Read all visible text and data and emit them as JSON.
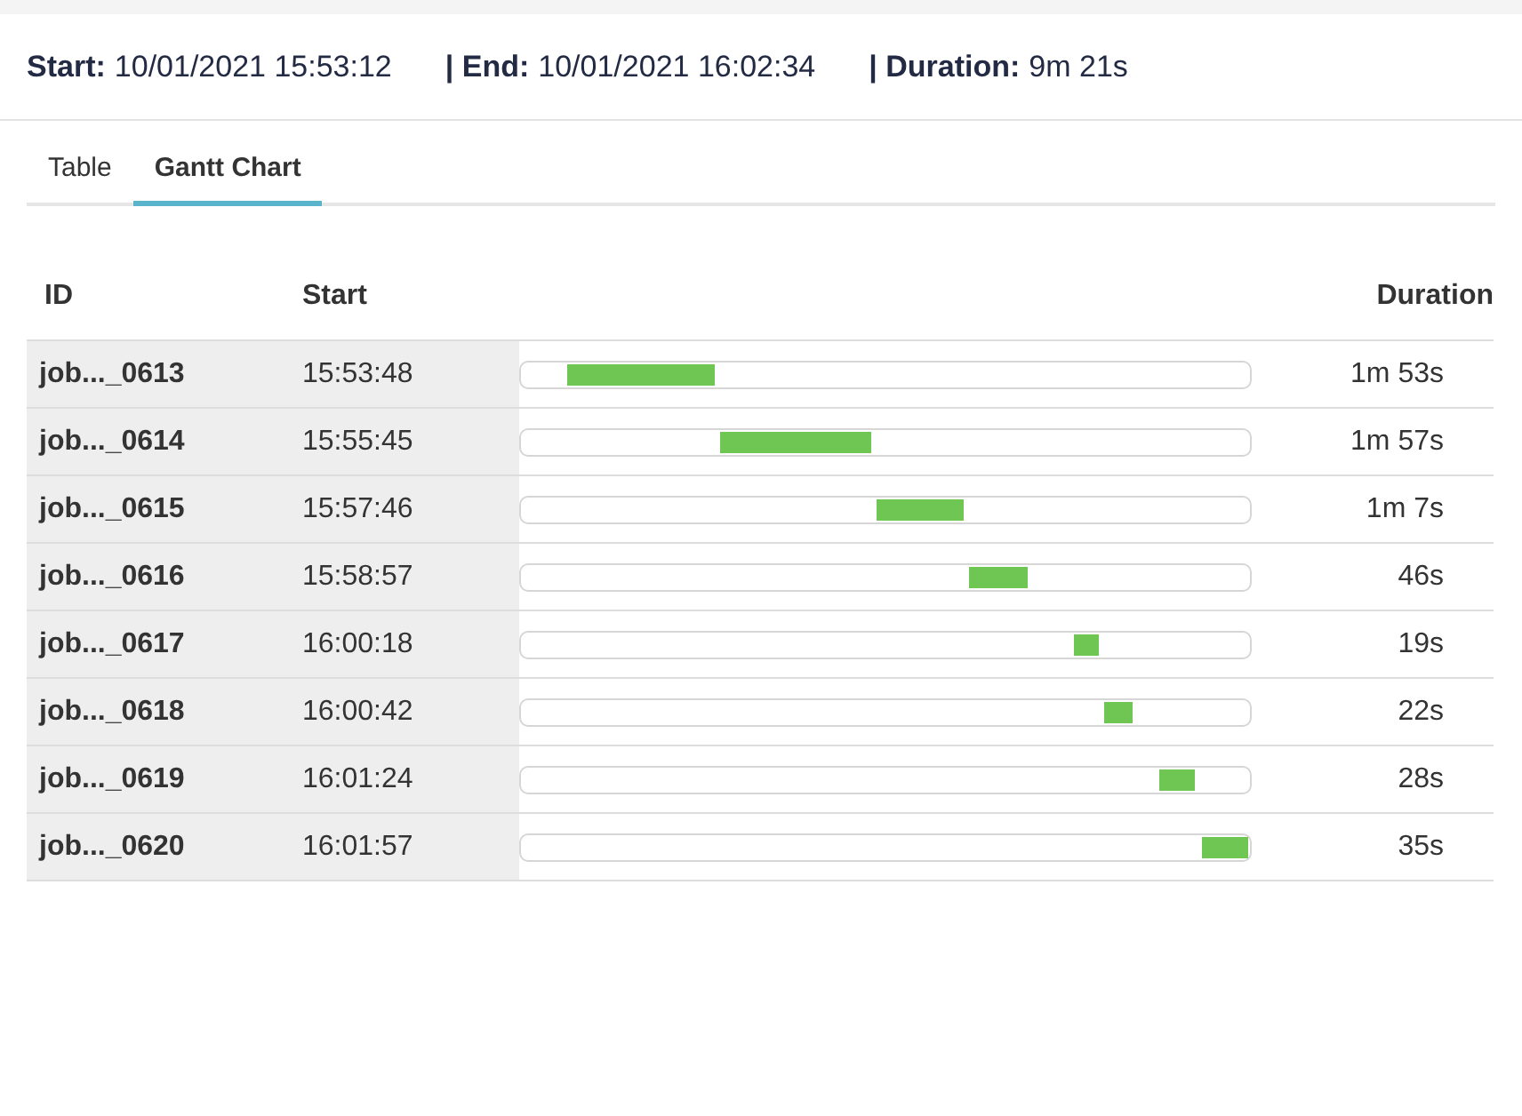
{
  "summary": [
    {
      "label": "Start:",
      "value": "10/01/2021 15:53:12"
    },
    {
      "label": "| End:",
      "value": "10/01/2021 16:02:34"
    },
    {
      "label": "| Duration:",
      "value": "9m 21s"
    }
  ],
  "tabs": [
    {
      "label": "Table",
      "selected": false
    },
    {
      "label": "Gantt Chart",
      "selected": true
    }
  ],
  "table": {
    "columns": [
      "ID",
      "Start",
      "Duration"
    ],
    "rows": [
      {
        "id": "job..._0613",
        "start": "15:53:48",
        "duration": "1m 53s"
      },
      {
        "id": "job..._0614",
        "start": "15:55:45",
        "duration": "1m 57s"
      },
      {
        "id": "job..._0615",
        "start": "15:57:46",
        "duration": "1m 7s"
      },
      {
        "id": "job..._0616",
        "start": "15:58:57",
        "duration": "46s"
      },
      {
        "id": "job..._0617",
        "start": "16:00:18",
        "duration": "19s"
      },
      {
        "id": "job..._0618",
        "start": "16:00:42",
        "duration": "22s"
      },
      {
        "id": "job..._0619",
        "start": "16:01:24",
        "duration": "28s"
      },
      {
        "id": "job..._0620",
        "start": "16:01:57",
        "duration": "35s"
      }
    ]
  }
}
